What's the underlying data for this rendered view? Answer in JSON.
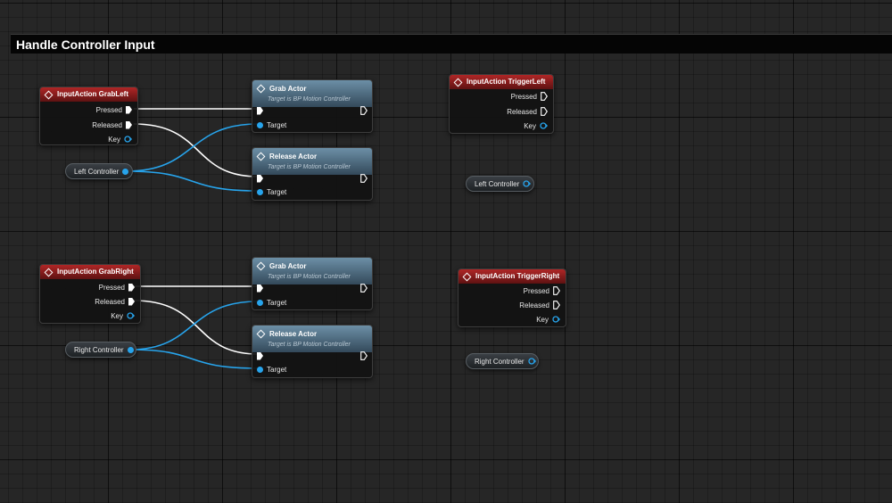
{
  "comment": {
    "title": "Handle Controller Input"
  },
  "pins": {
    "pressed": "Pressed",
    "released": "Released",
    "key": "Key",
    "target": "Target"
  },
  "nodes": {
    "grab_left_event": {
      "title": "InputAction GrabLeft"
    },
    "grab_right_event": {
      "title": "InputAction GrabRight"
    },
    "trigger_left_event": {
      "title": "InputAction TriggerLeft"
    },
    "trigger_right_event": {
      "title": "InputAction TriggerRight"
    },
    "grab_actor_top": {
      "title": "Grab Actor",
      "subtitle": "Target is BP Motion Controller"
    },
    "release_actor_top": {
      "title": "Release Actor",
      "subtitle": "Target is BP Motion Controller"
    },
    "grab_actor_bottom": {
      "title": "Grab Actor",
      "subtitle": "Target is BP Motion Controller"
    },
    "release_actor_bottom": {
      "title": "Release Actor",
      "subtitle": "Target is BP Motion Controller"
    }
  },
  "variables": {
    "left_controller": "Left Controller",
    "right_controller": "Right Controller",
    "left_controller_loose": "Left Controller",
    "right_controller_loose": "Right Controller"
  },
  "colors": {
    "event_header": "#b02626",
    "function_header": "#5d7f96",
    "object_pin": "#27a4ec",
    "exec_wire": "#ffffff"
  },
  "icons": {
    "event": "event-diamond-icon",
    "function": "function-diamond-icon",
    "exec": "exec-pin-icon",
    "object": "object-pin-icon"
  }
}
